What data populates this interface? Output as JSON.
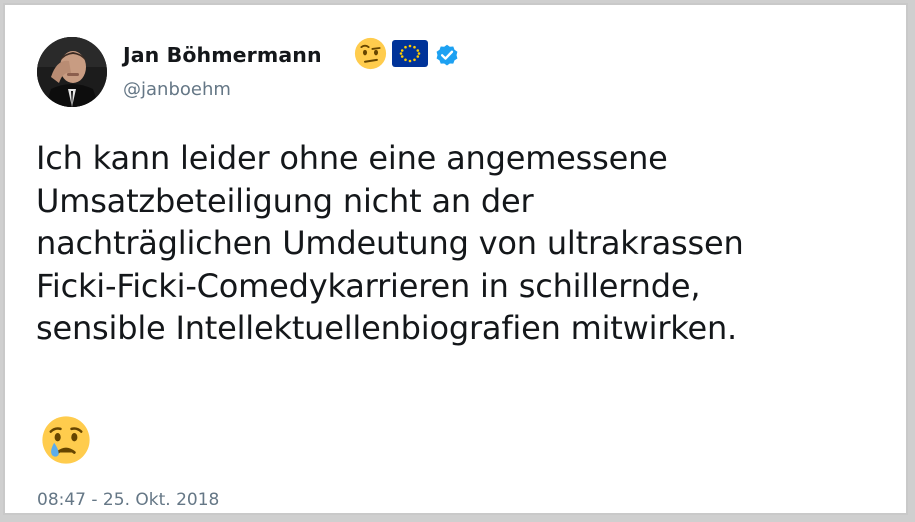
{
  "tweet": {
    "author": {
      "display_name": "Jan Böhmermann",
      "handle": "@janboehm",
      "name_icons": [
        "face-with-raised-eyebrow-emoji",
        "eu-flag-emoji",
        "verified-badge-icon"
      ]
    },
    "text_lines": [
      "Ich kann leider ohne eine angemessene",
      "Umsatzbeteiligung nicht an der",
      "nachträglichen Umdeutung von ultrakrassen",
      "Ficki-Ficki-Comedykarrieren in schillernde,",
      "sensible Intellektuellenbiografien mitwirken."
    ],
    "trailing_emoji": "crying-face-emoji",
    "timestamp": "08:47 - 25. Okt. 2018"
  },
  "colors": {
    "text": "#14171a",
    "secondary": "#657786",
    "verified": "#1da1f2",
    "eu_blue": "#003399",
    "eu_star": "#ffcc00",
    "emoji_yellow": "#ffcc4d"
  }
}
